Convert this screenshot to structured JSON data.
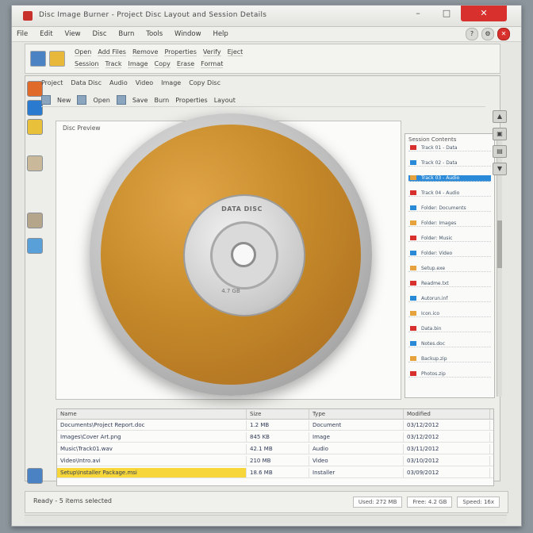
{
  "window": {
    "title": "Disc Image Burner - Project Disc Layout and Session Details",
    "min": "–",
    "max": "□",
    "close": "✕"
  },
  "menu": {
    "items": [
      "File",
      "Edit",
      "View",
      "Disc",
      "Burn",
      "Tools",
      "Window",
      "Help"
    ],
    "right_buttons": [
      "?",
      "⚙",
      "✕"
    ]
  },
  "ribbon": {
    "row1": [
      "Open",
      "Add Files",
      "Remove",
      "Properties",
      "Verify",
      "Eject"
    ],
    "row2": [
      "Session",
      "Track",
      "Image",
      "Copy",
      "Erase",
      "Format"
    ]
  },
  "inner": {
    "tabs": [
      "Project",
      "Data Disc",
      "Audio",
      "Video",
      "Image",
      "Copy Disc"
    ],
    "toolbar": [
      "New",
      "Open",
      "Save",
      "Burn",
      "Properties",
      "Layout"
    ],
    "canvas_caption": "Disc Preview",
    "disc_label": "DATA DISC",
    "disc_sub": "4.7 GB"
  },
  "side_panel": {
    "title": "Session Contents",
    "rows": [
      {
        "label": "Track 01 - Data",
        "selected": false
      },
      {
        "label": "Track 02 - Data",
        "selected": false
      },
      {
        "label": "Track 03 - Audio",
        "selected": true
      },
      {
        "label": "Track 04 - Audio",
        "selected": false
      },
      {
        "label": "Folder: Documents",
        "selected": false
      },
      {
        "label": "Folder: Images",
        "selected": false
      },
      {
        "label": "Folder: Music",
        "selected": false
      },
      {
        "label": "Folder: Video",
        "selected": false
      },
      {
        "label": "Setup.exe",
        "selected": false
      },
      {
        "label": "Readme.txt",
        "selected": false
      },
      {
        "label": "Autorun.inf",
        "selected": false
      },
      {
        "label": "Icon.ico",
        "selected": false
      },
      {
        "label": "Data.bin",
        "selected": false
      },
      {
        "label": "Notes.doc",
        "selected": false
      },
      {
        "label": "Backup.zip",
        "selected": false
      },
      {
        "label": "Photos.zip",
        "selected": false
      }
    ],
    "bar_colors": [
      "#d8302c",
      "#2a8ad8",
      "#e6a23c",
      "#d8302c",
      "#2a8ad8",
      "#e6a23c"
    ]
  },
  "right_rail": [
    "▲",
    "▣",
    "▤",
    "▼"
  ],
  "table": {
    "headers": [
      "Name",
      "Size",
      "Type",
      "Modified"
    ],
    "rows": [
      {
        "name": "Documents\\Project Report.doc",
        "size": "1.2 MB",
        "type": "Document",
        "modified": "03/12/2012"
      },
      {
        "name": "Images\\Cover Art.png",
        "size": "845 KB",
        "type": "Image",
        "modified": "03/12/2012"
      },
      {
        "name": "Music\\Track01.wav",
        "size": "42.1 MB",
        "type": "Audio",
        "modified": "03/11/2012"
      },
      {
        "name": "Video\\Intro.avi",
        "size": "210 MB",
        "type": "Video",
        "modified": "03/10/2012"
      },
      {
        "name": "Setup\\Installer Package.msi",
        "size": "18.6 MB",
        "type": "Installer",
        "modified": "03/09/2012",
        "highlight": true
      }
    ]
  },
  "status": {
    "text": "Ready - 5 items selected",
    "fields": [
      "Used: 272 MB",
      "Free: 4.2 GB",
      "Speed: 16x"
    ]
  }
}
